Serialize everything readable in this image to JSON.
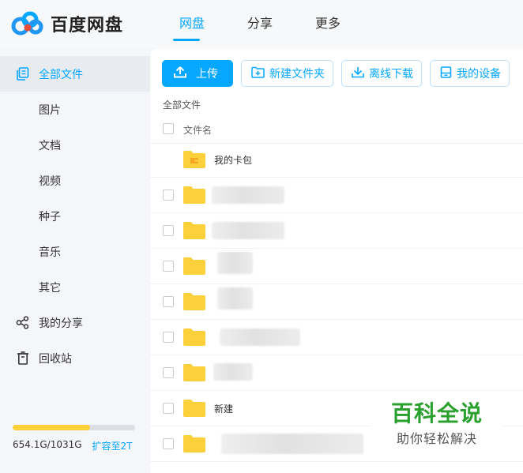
{
  "app": {
    "name": "百度网盘"
  },
  "top_nav": {
    "tabs": [
      {
        "label": "网盘"
      },
      {
        "label": "分享"
      },
      {
        "label": "更多"
      }
    ]
  },
  "sidebar": {
    "items": [
      {
        "label": "全部文件",
        "icon": "files-icon"
      },
      {
        "label": "图片"
      },
      {
        "label": "文档"
      },
      {
        "label": "视频"
      },
      {
        "label": "种子"
      },
      {
        "label": "音乐"
      },
      {
        "label": "其它"
      },
      {
        "label": "我的分享",
        "icon": "share-icon"
      },
      {
        "label": "回收站",
        "icon": "trash-icon"
      }
    ],
    "storage": {
      "used_text": "654.1G/1031G",
      "expand_label": "扩容至2T",
      "used_fraction": 0.634
    }
  },
  "toolbar": {
    "upload": "上传",
    "new_folder": "新建文件夹",
    "offline_download": "离线下载",
    "my_devices": "我的设备"
  },
  "breadcrumb": "全部文件",
  "list": {
    "column_name": "文件名",
    "rows": [
      {
        "name": "我的卡包",
        "icon": "wallet-folder-icon"
      },
      {
        "name": "",
        "icon": "folder-icon"
      },
      {
        "name": "",
        "icon": "folder-icon"
      },
      {
        "name": "",
        "icon": "folder-icon"
      },
      {
        "name": "",
        "icon": "folder-icon"
      },
      {
        "name": "",
        "icon": "folder-icon"
      },
      {
        "name": "",
        "icon": "folder-icon"
      },
      {
        "name": "新建",
        "icon": "folder-icon"
      },
      {
        "name": "",
        "icon": "folder-icon"
      }
    ]
  },
  "watermark": {
    "title": "百科全说",
    "subtitle": "助你轻松解决"
  },
  "colors": {
    "accent": "#06a7ff",
    "folder": "#fbd03a",
    "active_bg": "#e8ebf0",
    "watermark_green": "#2aa12e"
  }
}
